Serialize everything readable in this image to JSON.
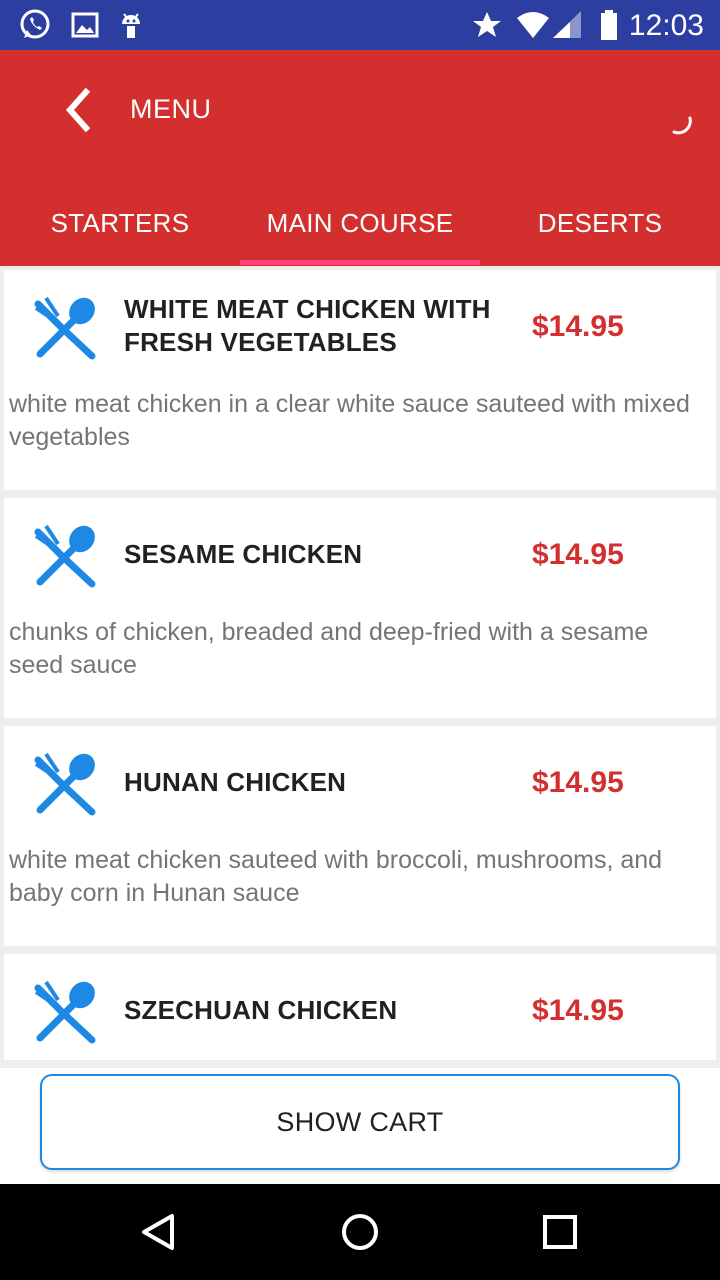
{
  "status_bar": {
    "time": "12:03",
    "left_icons": [
      "whatsapp-icon",
      "image-icon",
      "android-icon"
    ],
    "right_icons": [
      "star-icon",
      "wifi-icon",
      "cell-signal-icon",
      "battery-icon"
    ]
  },
  "app_bar": {
    "title": "MENU",
    "background": "#d32f2f"
  },
  "tabs": [
    {
      "label": "STARTERS",
      "selected": false
    },
    {
      "label": "MAIN COURSE",
      "selected": true
    },
    {
      "label": "DESERTS",
      "selected": false
    }
  ],
  "dishes": [
    {
      "name": "WHITE MEAT CHICKEN WITH FRESH VEGETABLES",
      "price": "$14.95",
      "description": "white meat chicken in a clear white sauce sauteed with mixed vegetables"
    },
    {
      "name": "SESAME CHICKEN",
      "price": "$14.95",
      "description": "chunks of chicken, breaded and deep-fried with a sesame seed sauce"
    },
    {
      "name": "HUNAN CHICKEN",
      "price": "$14.95",
      "description": "white meat chicken sauteed with broccoli, mushrooms, and baby corn in Hunan sauce"
    },
    {
      "name": "SZECHUAN CHICKEN",
      "price": "$14.95",
      "description": ""
    }
  ],
  "cart": {
    "button_label": "SHOW CART"
  },
  "colors": {
    "status_bar": "#2c3e9f",
    "accent": "#d32f2f",
    "tab_indicator": "#ff4081",
    "icon_blue": "#1e88e5"
  }
}
